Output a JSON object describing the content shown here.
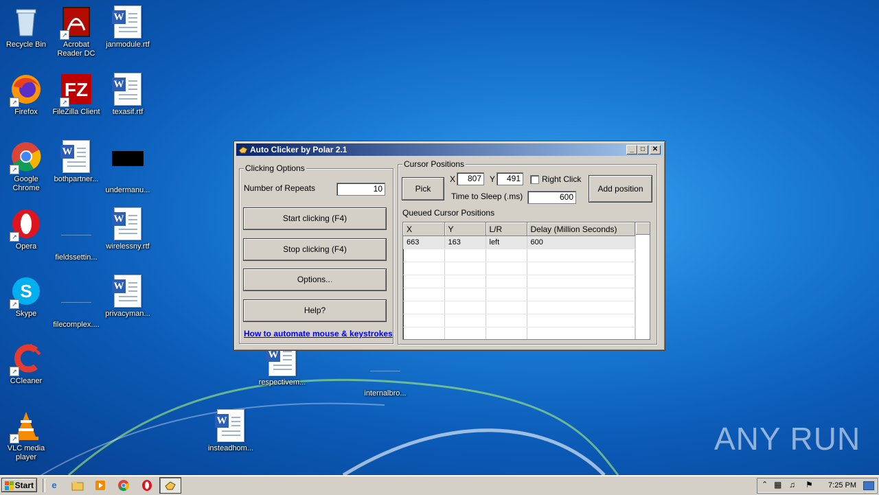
{
  "desktop": {
    "icons": [
      {
        "label": "Recycle Bin",
        "icon": "recycle-bin-icon"
      },
      {
        "label": "Acrobat Reader DC",
        "icon": "acrobat-icon"
      },
      {
        "label": "janmodule.rtf",
        "icon": "word-document-icon"
      },
      {
        "label": "Firefox",
        "icon": "firefox-icon"
      },
      {
        "label": "FileZilla Client",
        "icon": "filezilla-icon"
      },
      {
        "label": "texasif.rtf",
        "icon": "word-document-icon"
      },
      {
        "label": "Google Chrome",
        "icon": "chrome-icon"
      },
      {
        "label": "bothpartner...",
        "icon": "word-document-icon"
      },
      {
        "label": "undermanu...",
        "icon": "blank-file-icon"
      },
      {
        "label": "Opera",
        "icon": "opera-icon"
      },
      {
        "label": "fieldssettin...",
        "icon": "blank-file-icon"
      },
      {
        "label": "wirelessny.rtf",
        "icon": "word-document-icon"
      },
      {
        "label": "Skype",
        "icon": "skype-icon"
      },
      {
        "label": "filecomplex....",
        "icon": "blank-file-icon"
      },
      {
        "label": "privacyman...",
        "icon": "word-document-icon"
      },
      {
        "label": "CCleaner",
        "icon": "ccleaner-icon"
      },
      {
        "label": "respectivem...",
        "icon": "word-document-icon"
      },
      {
        "label": "internalbro...",
        "icon": "blank-file-icon"
      },
      {
        "label": "VLC media player",
        "icon": "vlc-icon"
      },
      {
        "label": "insteadhom...",
        "icon": "word-document-icon"
      }
    ],
    "watermark": "ANY RUN"
  },
  "window": {
    "title": "Auto Clicker by Polar 2.1",
    "controls": {
      "minimize": "_",
      "maximize": "□",
      "close": "✕"
    },
    "clicking_options": {
      "caption": "Clicking Options",
      "repeats_label": "Number of Repeats",
      "repeats_value": "10",
      "start_button": "Start clicking (F4)",
      "stop_button": "Stop clicking (F4)",
      "options_button": "Options...",
      "help_button": "Help?",
      "link": "How to automate mouse & keystrokes"
    },
    "cursor_positions": {
      "caption": "Cursor Positions",
      "pick_button": "Pick",
      "x_label": "X",
      "x_value": "807",
      "y_label": "Y",
      "y_value": "491",
      "right_click_label": "Right Click",
      "right_click_checked": false,
      "sleep_label": "Time to Sleep (.ms)",
      "sleep_value": "600",
      "add_button": "Add position",
      "queue_label": "Queued Cursor Positions",
      "columns": [
        "X",
        "Y",
        "L/R",
        "Delay (Million Seconds)"
      ],
      "rows": [
        [
          "663",
          "163",
          "left",
          "600"
        ]
      ]
    }
  },
  "taskbar": {
    "start_label": "Start",
    "clock": "7:25 PM",
    "pinned": [
      "ie-icon",
      "explorer-icon",
      "media-player-icon",
      "chrome-icon",
      "opera-icon",
      "auto-clicker-icon"
    ]
  }
}
